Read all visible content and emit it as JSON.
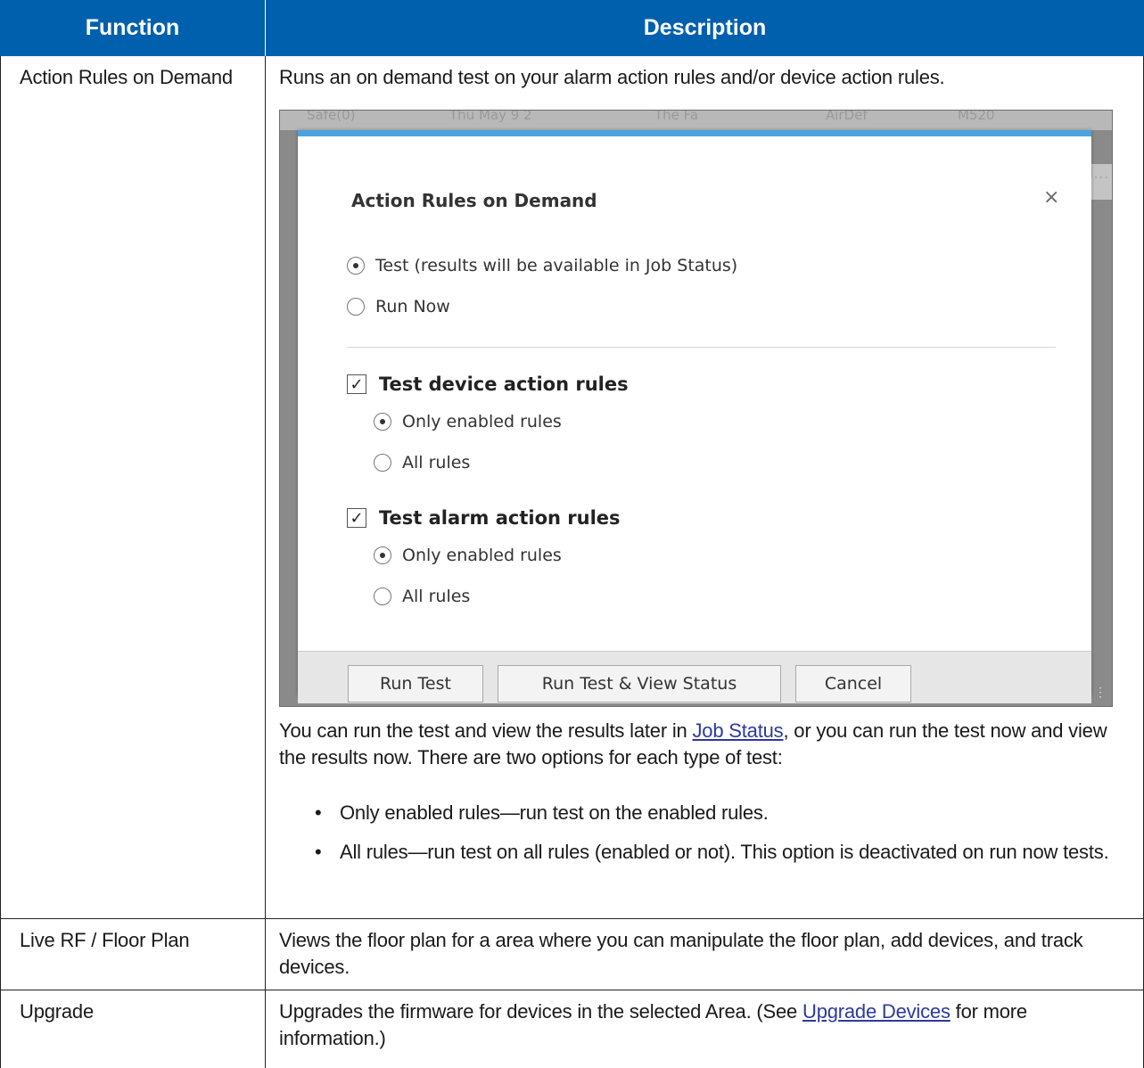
{
  "table": {
    "headers": {
      "function": "Function",
      "description": "Description"
    },
    "rows": [
      {
        "function": "Action Rules on Demand",
        "intro": "Runs an on demand test on your alarm action rules and/or device action rules.",
        "after_pre": "You can run the test and view the results later in ",
        "after_link": "Job Status",
        "after_post": ", or you can run the test now and view the results now. There are two options for each type of test:",
        "bullets": [
          "Only enabled rules—run test on the enabled rules.",
          "All rules—run test on all rules (enabled or not). This option is deactivated on run now tests."
        ]
      },
      {
        "function": "Live RF / Floor Plan",
        "description": "Views the floor plan for a area where you can manipulate the floor plan, add devices, and track devices."
      },
      {
        "function": "Upgrade",
        "desc_pre": "Upgrades the firmware for devices in the selected Area. (See ",
        "desc_link": "Upgrade Devices",
        "desc_post": " for more information.)"
      }
    ]
  },
  "dialog": {
    "background_strip": [
      "Safe(0)",
      "Thu May 9 2",
      "The Fa",
      "AirDef",
      "M520"
    ],
    "background_right": "I...",
    "title": "Action Rules on Demand",
    "close": "×",
    "mode_options": [
      {
        "label": "Test (results will be available in Job Status)",
        "selected": true
      },
      {
        "label": "Run Now",
        "selected": false
      }
    ],
    "groups": [
      {
        "label": "Test device action rules",
        "checked": true,
        "check_mark": "✓",
        "options": [
          {
            "label": "Only enabled rules",
            "selected": true
          },
          {
            "label": "All rules",
            "selected": false
          }
        ]
      },
      {
        "label": "Test alarm action rules",
        "checked": true,
        "check_mark": "✓",
        "options": [
          {
            "label": "Only enabled rules",
            "selected": true
          },
          {
            "label": "All rules",
            "selected": false
          }
        ]
      }
    ],
    "buttons": {
      "run_test": "Run Test",
      "run_test_view": "Run Test & View Status",
      "cancel": "Cancel"
    },
    "colors": {
      "header_blue": "#0060ae",
      "dialog_accent": "#4aa3dc"
    }
  }
}
